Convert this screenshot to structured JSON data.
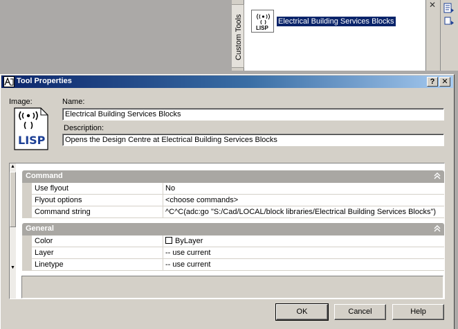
{
  "palette": {
    "tab_label": "Custom Tools",
    "tool_label": "Electrical Building Services Blocks",
    "close_glyph": "✕"
  },
  "dialog": {
    "title": "Tool Properties",
    "help_glyph": "?",
    "close_glyph": "✕",
    "image_label": "Image:",
    "name_label": "Name:",
    "name_value": "Electrical Building Services Blocks",
    "description_label": "Description:",
    "description_value": "Opens the Design Centre at Electrical Building Services Blocks",
    "icon_text": "LISP"
  },
  "sections": [
    {
      "title": "Command",
      "rows": [
        {
          "key": "Use flyout",
          "value": "No"
        },
        {
          "key": "Flyout options",
          "value": "<choose commands>"
        },
        {
          "key": "Command string",
          "value": "^C^C(adc:go \"S:/Cad/LOCAL/block libraries/Electrical Building Services Blocks\")"
        }
      ]
    },
    {
      "title": "General",
      "rows": [
        {
          "key": "Color",
          "value": "ByLayer"
        },
        {
          "key": "Layer",
          "value": "-- use current"
        },
        {
          "key": "Linetype",
          "value": "-- use current"
        }
      ]
    }
  ],
  "buttons": {
    "ok": "OK",
    "cancel": "Cancel",
    "help": "Help"
  },
  "colors": {
    "title_start": "#0a246a",
    "title_end": "#a6caf0",
    "selection": "#0a246a",
    "section_header": "#a9a7a3"
  },
  "icons": {
    "lisp": "lisp-tool-icon",
    "collapse": "double-chevron-up-icon"
  }
}
